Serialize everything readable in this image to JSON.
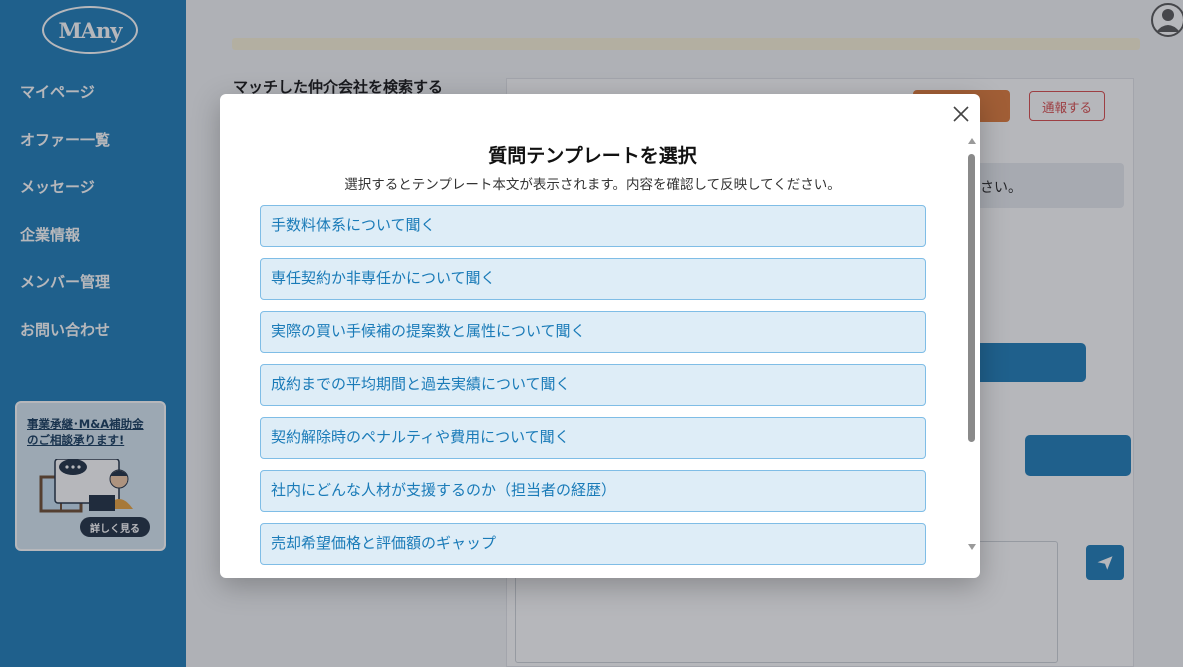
{
  "app": {
    "logo_text": "MAny"
  },
  "sidebar": {
    "items": [
      {
        "label": "マイページ"
      },
      {
        "label": "オファー一覧"
      },
      {
        "label": "メッセージ"
      },
      {
        "label": "企業情報"
      },
      {
        "label": "メンバー管理"
      },
      {
        "label": "お問い合わせ"
      }
    ],
    "promo": {
      "title_line1": "事業承継･M&A補助金",
      "title_line2": "のご相談承ります!",
      "button_label": "詳しく見る"
    }
  },
  "background": {
    "search_title": "マッチした仲介会社を検索する",
    "report_label": "通報する",
    "banner_text_fragment": "さい。"
  },
  "modal": {
    "title": "質問テンプレートを選択",
    "subtitle": "選択するとテンプレート本文が表示されます。内容を確認して反映してください。",
    "templates": [
      "手数料体系について聞く",
      "専任契約か非専任かについて聞く",
      "実際の買い手候補の提案数と属性について聞く",
      "成約までの平均期間と過去実績について聞く",
      "契約解除時のペナルティや費用について聞く",
      "社内にどんな人材が支援するのか（担当者の経歴）",
      "売却希望価格と評価額のギャップ"
    ]
  },
  "colors": {
    "primary": "#1a7bb8",
    "accent_orange": "#e07936",
    "danger": "#d94a4a",
    "item_bg": "#deedf7"
  }
}
